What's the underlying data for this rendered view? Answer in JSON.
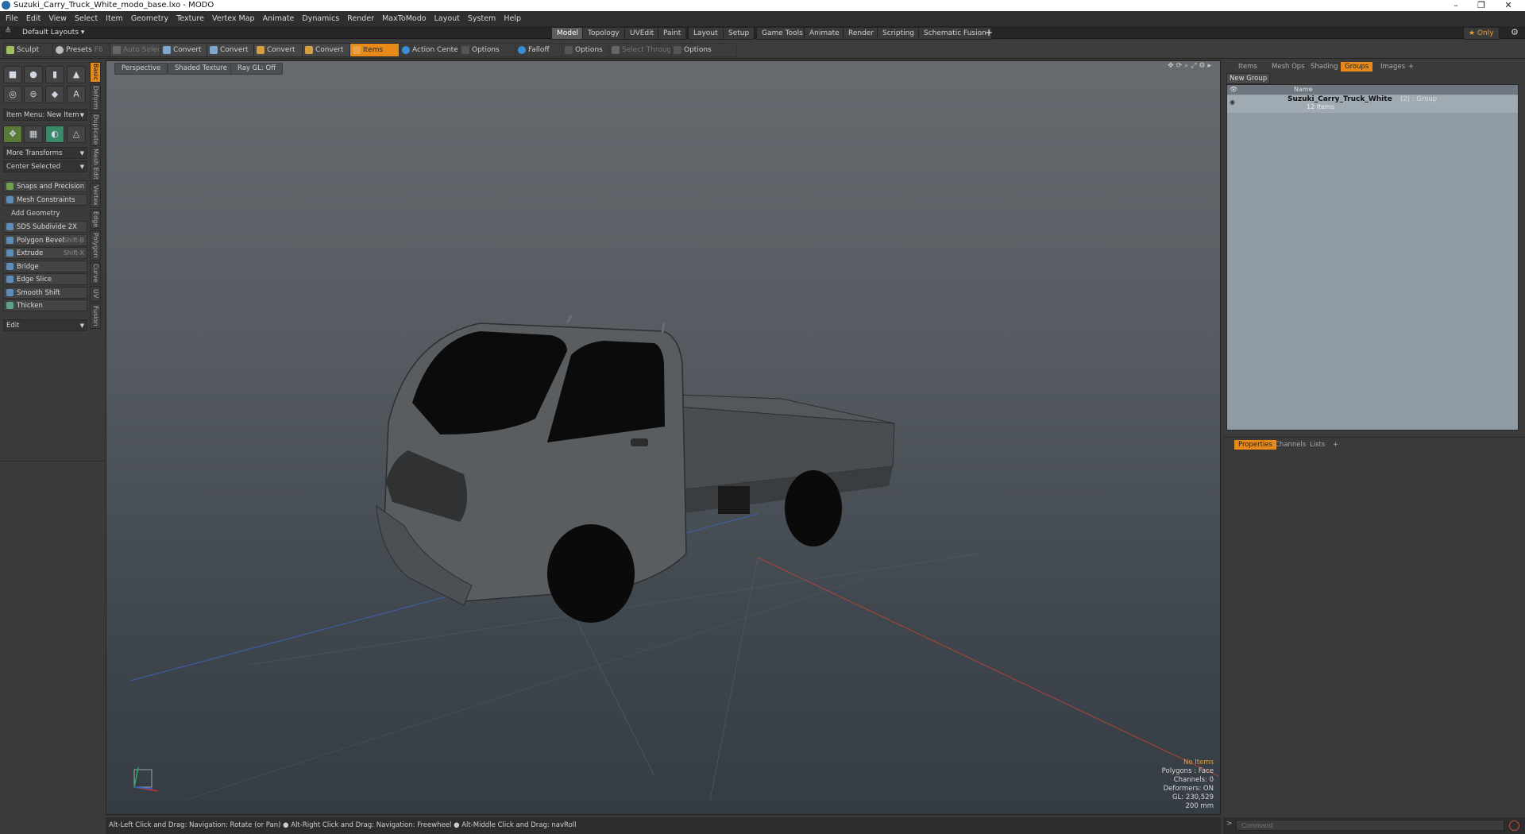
{
  "window": {
    "title": "Suzuki_Carry_Truck_White_modo_base.lxo - MODO",
    "minimize": "–",
    "maximize": "❐",
    "close": "✕"
  },
  "menu": [
    "File",
    "Edit",
    "View",
    "Select",
    "Item",
    "Geometry",
    "Texture",
    "Vertex Map",
    "Animate",
    "Dynamics",
    "Render",
    "MaxToModo",
    "Layout",
    "System",
    "Help"
  ],
  "layouts": {
    "default_label": "Default Layouts ▾",
    "tabs": [
      "Model",
      "Topology",
      "UVEdit",
      "Paint",
      "Layout",
      "Setup",
      "Game Tools",
      "Animate",
      "Render",
      "Scripting",
      "Schematic Fusion"
    ],
    "active": "Model",
    "add": "+",
    "only": "★ Only"
  },
  "toolbar": {
    "sculpt": "Sculpt",
    "presets": "Presets",
    "presets_key": "F6",
    "auto_select": "Auto Select",
    "convert1": "Convert",
    "convert2": "Convert",
    "convert3": "Convert",
    "convert4": "Convert",
    "items": "Items",
    "action_center": "Action Center",
    "options1": "Options",
    "falloff": "Falloff",
    "options2": "Options",
    "select_through": "Select Through",
    "options3": "Options"
  },
  "left": {
    "item_menu": "Item Menu: New Item",
    "more_transforms": "More Transforms",
    "center_selected": "Center Selected",
    "snaps": "Snaps and Precision",
    "mesh_constraints": "Mesh Constraints",
    "add_geometry": "Add Geometry",
    "tools": [
      {
        "label": "SDS Subdivide 2X",
        "shortcut": ""
      },
      {
        "label": "Polygon Bevel",
        "shortcut": "Shift-B"
      },
      {
        "label": "Extrude",
        "shortcut": "Shift-X"
      },
      {
        "label": "Bridge",
        "shortcut": ""
      },
      {
        "label": "Edge Slice",
        "shortcut": ""
      },
      {
        "label": "Smooth Shift",
        "shortcut": ""
      },
      {
        "label": "Thicken",
        "shortcut": ""
      }
    ],
    "edit": "Edit",
    "vtabs": [
      "Basic",
      "Deform",
      "Duplicate",
      "Mesh Edit",
      "Vertex",
      "Edge",
      "Polygon",
      "Curve",
      "UV",
      "Fusion"
    ]
  },
  "viewport": {
    "view": "Perspective",
    "shading": "Shaded Texture",
    "raygl": "Ray GL: Off",
    "stats": {
      "no_items": "No Items",
      "polygons": "Polygons : Face",
      "channels": "Channels: 0",
      "deformers": "Deformers: ON",
      "gl": "GL: 230,529",
      "unit": "200 mm"
    },
    "colors": {
      "x_axis": "#c0392b",
      "y_axis": "#27ae60",
      "z_axis": "#2a5fd6"
    }
  },
  "right": {
    "tabs": [
      "Items",
      "Mesh Ops",
      "Shading",
      "Groups",
      "Images"
    ],
    "active": "Groups",
    "add": "+",
    "new_group": "New Group",
    "name_col": "Name",
    "group_name": "Suzuki_Carry_Truck_White",
    "group_suffix": "(2) : Group",
    "group_items": "12 Items"
  },
  "props": {
    "tabs": [
      "Properties",
      "Channels",
      "Lists"
    ],
    "active": "Properties",
    "add": "+"
  },
  "status": {
    "text": "Alt-Left Click and Drag: Navigation: Rotate (or Pan) ● Alt-Right Click and Drag: Navigation: Freewheel ● Alt-Middle Click and Drag: navRoll"
  },
  "command": {
    "placeholder": "Command",
    "prompt": ">"
  }
}
